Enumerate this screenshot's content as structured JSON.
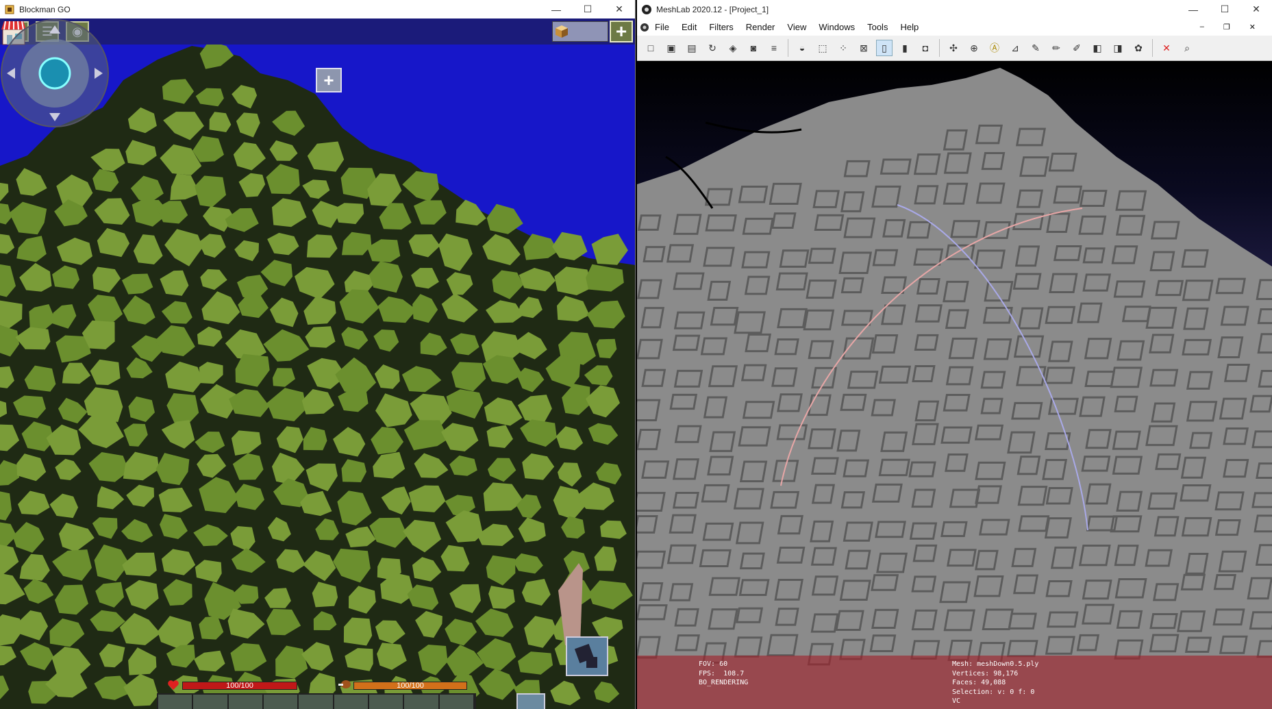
{
  "left_window": {
    "title": "Blockman GO",
    "window_controls": [
      "—",
      "☐",
      "✕"
    ],
    "hud": {
      "settings_icon": "gear-icon",
      "chat_icon": "chat-icon",
      "camera_icon": "camera-icon",
      "shop_icon": "shop-icon",
      "add_icon": "plus-icon",
      "health_label": "100/100",
      "hunger_label": "100/100",
      "health": 1.0,
      "hunger": 1.0,
      "hotbar_slots": 9
    },
    "colors": {
      "sky": "#1717c9",
      "grass": "#6b8f2e",
      "dark": "#1f2a14",
      "health": "#c01818",
      "hunger": "#d2701a"
    }
  },
  "right_window": {
    "title": "MeshLab 2020.12 - [Project_1]",
    "window_controls": [
      "—",
      "☐",
      "✕"
    ],
    "menu": [
      "File",
      "Edit",
      "Filters",
      "Render",
      "View",
      "Windows",
      "Tools",
      "Help"
    ],
    "mdi_controls": [
      "–",
      "❐",
      "✕"
    ],
    "toolbar_icons": [
      "new-project-icon",
      "open-project-icon",
      "import-mesh-icon",
      "reload-icon",
      "export-mesh-icon",
      "snapshot-icon",
      "layers-icon",
      "render-mode-icon",
      "bbox-icon",
      "points-icon",
      "wireframe-icon",
      "flat-icon",
      "smooth-icon",
      "texture-icon",
      "axis-icon",
      "sphere-icon",
      "annotation-icon",
      "measure-icon",
      "pick-icon",
      "paint-icon",
      "brush-icon",
      "select-faces-icon",
      "select-vertices-icon",
      "color-icon",
      "delete-icon",
      "search-icon"
    ],
    "info_left": {
      "fov": "FOV: 60",
      "fps": "FPS:  108.7",
      "mode": "BO_RENDERING"
    },
    "info_right": {
      "mesh": "Mesh: meshDown0.5.ply",
      "vertices": "Vertices: 98,176",
      "faces": "Faces: 49,088",
      "selection": "Selection: v: 0 f: 0",
      "vc": "VC"
    }
  }
}
